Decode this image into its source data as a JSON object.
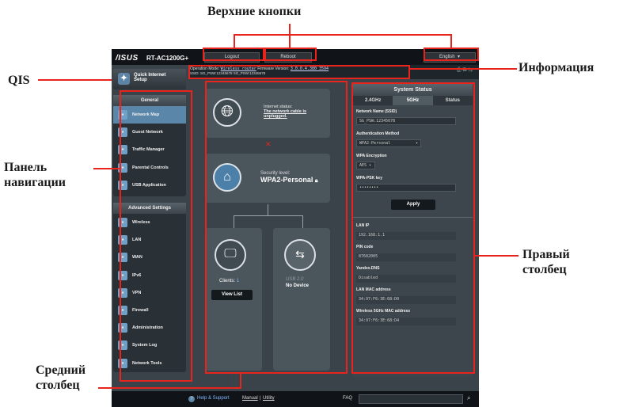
{
  "callouts": {
    "top_buttons": "Верхние кнопки",
    "info": "Информация",
    "qis": "QIS",
    "nav_panel_1": "Панель",
    "nav_panel_2": "навигации",
    "right_col_1": "Правый",
    "right_col_2": "столбец",
    "mid_col_1": "Средний",
    "mid_col_2": "столбец"
  },
  "header": {
    "logo": "/ISUS",
    "model": "RT-AC1200G+",
    "logout": "Logout",
    "reboot": "Reboot",
    "language": "English"
  },
  "info": {
    "op_mode_label": "Operation Mode:",
    "op_mode": "Wireless router",
    "fw_label": "Firmware Version:",
    "fw": "3.0.0.4.380_3594",
    "ssid_line": "SSID: SG_PSW:12345678 SG_PSW:12345678"
  },
  "sidebar": {
    "qis_1": "Quick Internet",
    "qis_2": "Setup",
    "general_header": "General",
    "general_items": [
      {
        "label": "Network Map",
        "icon": "network-map-icon",
        "active": true
      },
      {
        "label": "Guest Network",
        "icon": "guest-network-icon"
      },
      {
        "label": "Traffic Manager",
        "icon": "traffic-manager-icon"
      },
      {
        "label": "Parental Controls",
        "icon": "parental-controls-icon"
      },
      {
        "label": "USB Application",
        "icon": "usb-application-icon"
      }
    ],
    "adv_header": "Advanced Settings",
    "adv_items": [
      {
        "label": "Wireless",
        "icon": "wireless-icon"
      },
      {
        "label": "LAN",
        "icon": "lan-icon"
      },
      {
        "label": "WAN",
        "icon": "wan-icon"
      },
      {
        "label": "IPv6",
        "icon": "ipv6-icon"
      },
      {
        "label": "VPN",
        "icon": "vpn-icon"
      },
      {
        "label": "Firewall",
        "icon": "firewall-icon"
      },
      {
        "label": "Administration",
        "icon": "administration-icon"
      },
      {
        "label": "System Log",
        "icon": "system-log-icon"
      },
      {
        "label": "Network Tools",
        "icon": "network-tools-icon"
      }
    ]
  },
  "map": {
    "internet_status": "Internet status:",
    "internet_msg_1": "The network cable is",
    "internet_msg_2": "unplugged.",
    "security_label": "Security level:",
    "security_value": "WPA2-Personal",
    "clients_label": "Clients:",
    "clients_count": "1",
    "view_list": "View List",
    "usb_label": "USB 2.0",
    "usb_status": "No Device"
  },
  "status": {
    "title": "System Status",
    "tabs": [
      "2.4GHz",
      "5GHz",
      "Status"
    ],
    "ssid_label": "Network Name (SSID)",
    "ssid": "SG_PSW:12345678",
    "auth_label": "Authentication Method",
    "auth": "WPA2-Personal",
    "enc_label": "WPA Encryption",
    "enc": "AES",
    "key_label": "WPA-PSK key",
    "key": "••••••••",
    "apply": "Apply",
    "lan_ip_label": "LAN IP",
    "lan_ip": "192.168.1.1",
    "pin_label": "PIN code",
    "pin": "87602005",
    "dns_label": "Yandex.DNS",
    "dns": "Disabled",
    "lan_mac_label": "LAN MAC address",
    "lan_mac": "34:97:F6:3E:68:D0",
    "w5_mac_label": "Wireless 5GHz MAC address",
    "w5_mac": "34:97:F6:3E:68:D4"
  },
  "footer": {
    "help": "Help & Support",
    "manual": "Manual",
    "sep": "|",
    "utility": "Utility",
    "faq": "FAQ"
  }
}
